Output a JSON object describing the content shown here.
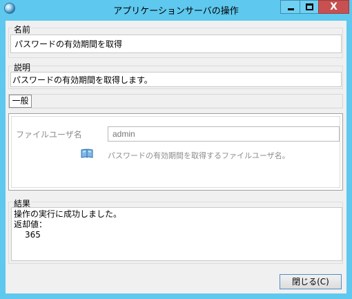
{
  "window": {
    "title": "アプリケーションサーバの操作",
    "icon": "globe-icon",
    "controls": {
      "minimize": "minimize-icon",
      "maximize": "maximize-icon",
      "close_label": "X"
    }
  },
  "name_group": {
    "label": "名前",
    "value": "パスワードの有効期間を取得"
  },
  "description_group": {
    "label": "説明",
    "value": "パスワードの有効期間を取得します。"
  },
  "tabs": [
    {
      "label": "一般",
      "selected": true
    }
  ],
  "parameters": [
    {
      "label": "ファイルユーザ名",
      "placeholder": "admin",
      "description": "パスワードの有効期間を取得するファイルユーザ名。",
      "icon": "book-icon"
    }
  ],
  "result_group": {
    "label": "結果",
    "lines": [
      "操作の実行に成功しました。",
      "返却値："
    ],
    "return_value": "365"
  },
  "buttons": {
    "close_label": "閉じる(C)"
  }
}
